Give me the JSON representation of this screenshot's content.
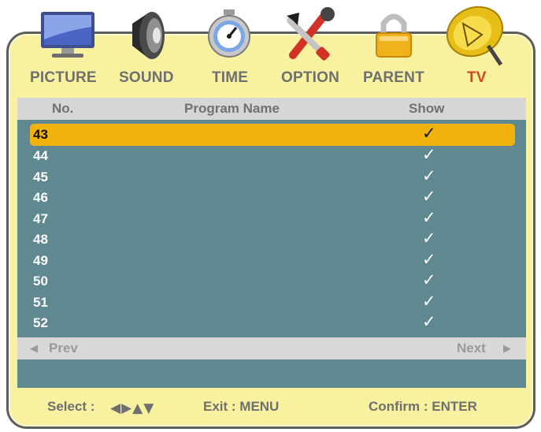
{
  "menu": {
    "tabs": [
      {
        "label": "PICTURE",
        "icon": "monitor-icon"
      },
      {
        "label": "SOUND",
        "icon": "speaker-icon"
      },
      {
        "label": "TIME",
        "icon": "stopwatch-icon"
      },
      {
        "label": "OPTION",
        "icon": "tools-icon"
      },
      {
        "label": "PARENT",
        "icon": "padlock-icon"
      },
      {
        "label": "TV",
        "icon": "satellite-dish-icon"
      }
    ],
    "active_tab": "TV"
  },
  "list": {
    "headers": {
      "no": "No.",
      "name": "Program Name",
      "show": "Show"
    },
    "rows": [
      {
        "no": "43",
        "name": "",
        "show": "✓",
        "selected": true
      },
      {
        "no": "44",
        "name": "",
        "show": "✓"
      },
      {
        "no": "45",
        "name": "",
        "show": "✓"
      },
      {
        "no": "46",
        "name": "",
        "show": "✓"
      },
      {
        "no": "47",
        "name": "",
        "show": "✓"
      },
      {
        "no": "48",
        "name": "",
        "show": "✓"
      },
      {
        "no": "49",
        "name": "",
        "show": "✓"
      },
      {
        "no": "50",
        "name": "",
        "show": "✓"
      },
      {
        "no": "51",
        "name": "",
        "show": "✓"
      },
      {
        "no": "52",
        "name": "",
        "show": "✓"
      }
    ]
  },
  "pager": {
    "prev": "Prev",
    "next": "Next",
    "prev_arrow": "◀",
    "next_arrow": "▶"
  },
  "footer": {
    "select_label": "Select :",
    "select_arrows": "◀▶▲▼",
    "exit": "Exit : MENU",
    "confirm": "Confirm : ENTER"
  },
  "colors": {
    "panel": "#f8f2a0",
    "list_bg": "#5f8891",
    "highlight": "#f2b20d",
    "active_tab": "#d24419",
    "tab_text": "#6f6f6f"
  }
}
